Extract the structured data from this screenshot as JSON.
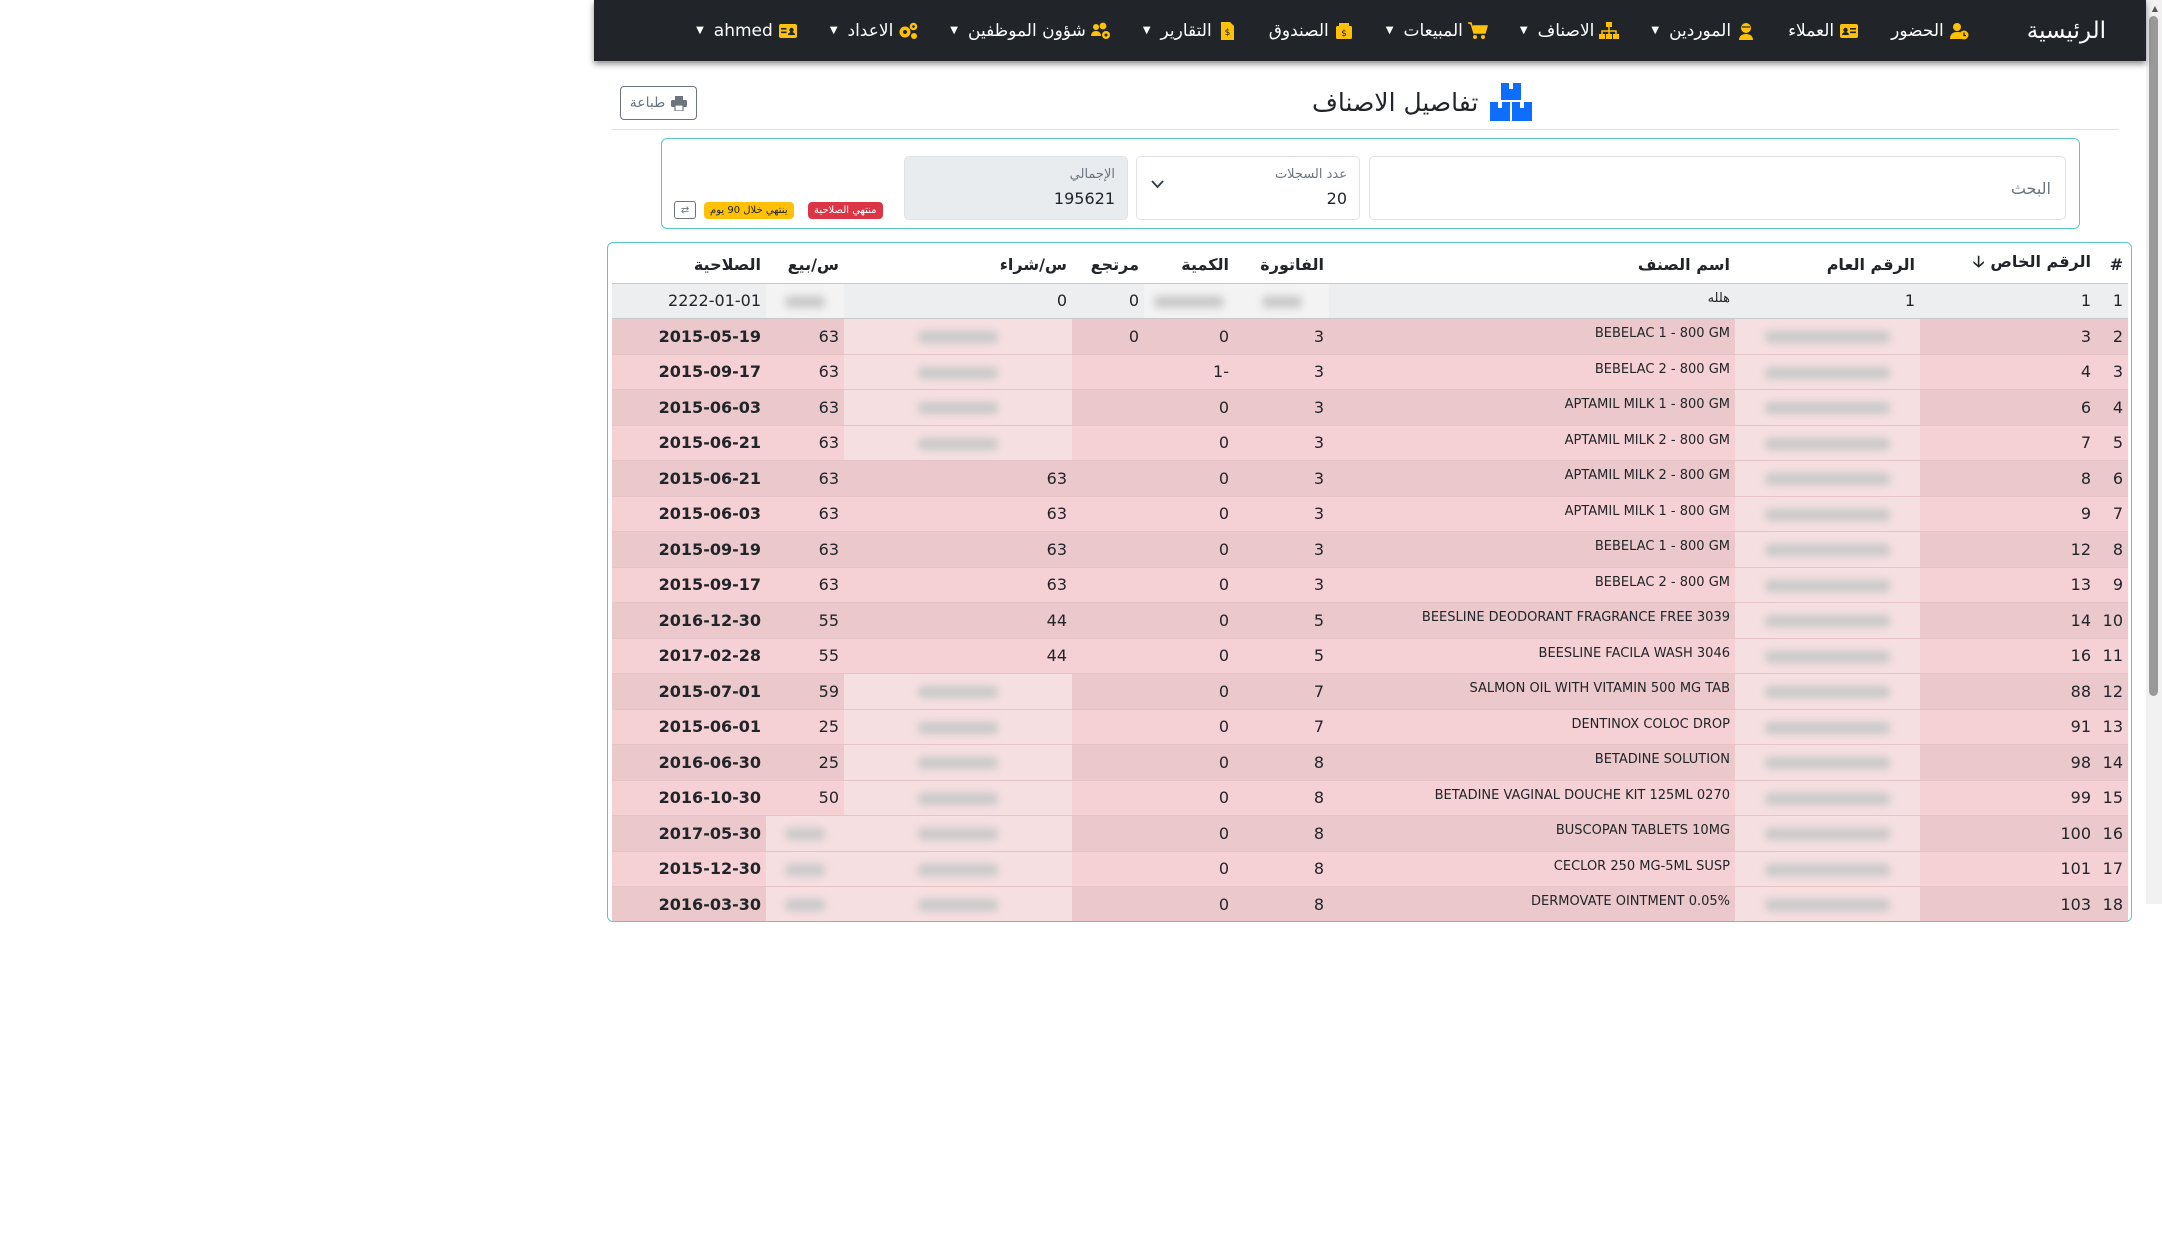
{
  "nav": {
    "brand": "الرئيسية",
    "items": [
      {
        "label": "الحضور",
        "icon": "user-clock-icon",
        "dropdown": false
      },
      {
        "label": "العملاء",
        "icon": "id-card-icon",
        "dropdown": false
      },
      {
        "label": "الموردين",
        "icon": "user-tie-icon",
        "dropdown": true
      },
      {
        "label": "الاصناف",
        "icon": "sitemap-icon",
        "dropdown": true
      },
      {
        "label": "المبيعات",
        "icon": "cart-icon",
        "dropdown": true
      },
      {
        "label": "الصندوق",
        "icon": "cash-box-icon",
        "dropdown": false
      },
      {
        "label": "التقارير",
        "icon": "invoice-icon",
        "dropdown": true
      },
      {
        "label": "شؤون الموظفين",
        "icon": "users-cog-icon",
        "dropdown": true
      },
      {
        "label": "الاعداد",
        "icon": "gears-icon",
        "dropdown": true
      },
      {
        "label": "ahmed",
        "icon": "id-badge-icon",
        "dropdown": true
      }
    ]
  },
  "page": {
    "title": "تفاصيل الاصناف",
    "print_label": "طباعة"
  },
  "filters": {
    "search_placeholder": "البحث",
    "records_label": "عدد السجلات",
    "records_value": "20",
    "total_label": "الإجمالي",
    "total_value": "195621",
    "badge_expired": "منتهي الصلاحية",
    "badge_soon": "ينتهي خلال 90 يوم"
  },
  "table": {
    "headers": [
      "#",
      "الرقم الخاص",
      "الرقم العام",
      "اسم الصنف",
      "الفاتورة",
      "الكمية",
      "مرتجع",
      "س/شراء",
      "س/بيع",
      "الصلاحية"
    ],
    "sort_indicator": "🡣",
    "rows": [
      {
        "n": "1",
        "code": "1",
        "general": "1",
        "name": "هلله",
        "invoice": "",
        "qty": "",
        "ret": "0",
        "buy": "0",
        "sell": "",
        "exp": "2222-01-01"
      },
      {
        "n": "2",
        "code": "3",
        "general": "",
        "name": "BEBELAC 1 - 800 GM",
        "invoice": "3",
        "qty": "0",
        "ret": "0",
        "buy": "",
        "sell": "63",
        "exp": "2015-05-19"
      },
      {
        "n": "3",
        "code": "4",
        "general": "",
        "name": "BEBELAC 2 - 800 GM",
        "invoice": "3",
        "qty": "-1",
        "ret": "",
        "buy": "",
        "sell": "63",
        "exp": "2015-09-17"
      },
      {
        "n": "4",
        "code": "6",
        "general": "",
        "name": "APTAMIL MILK 1 - 800 GM",
        "invoice": "3",
        "qty": "0",
        "ret": "",
        "buy": "",
        "sell": "63",
        "exp": "2015-06-03"
      },
      {
        "n": "5",
        "code": "7",
        "general": "",
        "name": "APTAMIL MILK 2 - 800 GM",
        "invoice": "3",
        "qty": "0",
        "ret": "",
        "buy": "",
        "sell": "63",
        "exp": "2015-06-21"
      },
      {
        "n": "6",
        "code": "8",
        "general": "",
        "name": "APTAMIL MILK 2 - 800 GM",
        "invoice": "3",
        "qty": "0",
        "ret": "",
        "buy": "63",
        "sell": "63",
        "exp": "2015-06-21"
      },
      {
        "n": "7",
        "code": "9",
        "general": "",
        "name": "APTAMIL MILK 1 - 800 GM",
        "invoice": "3",
        "qty": "0",
        "ret": "",
        "buy": "63",
        "sell": "63",
        "exp": "2015-06-03"
      },
      {
        "n": "8",
        "code": "12",
        "general": "",
        "name": "BEBELAC 1 - 800 GM",
        "invoice": "3",
        "qty": "0",
        "ret": "",
        "buy": "63",
        "sell": "63",
        "exp": "2015-09-19"
      },
      {
        "n": "9",
        "code": "13",
        "general": "",
        "name": "BEBELAC 2 - 800 GM",
        "invoice": "3",
        "qty": "0",
        "ret": "",
        "buy": "63",
        "sell": "63",
        "exp": "2015-09-17"
      },
      {
        "n": "10",
        "code": "14",
        "general": "",
        "name": "BEESLINE DEODORANT FRAGRANCE FREE 3039",
        "invoice": "5",
        "qty": "0",
        "ret": "",
        "buy": "44",
        "sell": "55",
        "exp": "2016-12-30"
      },
      {
        "n": "11",
        "code": "16",
        "general": "",
        "name": "BEESLINE FACILA WASH 3046",
        "invoice": "5",
        "qty": "0",
        "ret": "",
        "buy": "44",
        "sell": "55",
        "exp": "2017-02-28"
      },
      {
        "n": "12",
        "code": "88",
        "general": "",
        "name": "SALMON OIL WITH VITAMIN 500 MG TAB",
        "invoice": "7",
        "qty": "0",
        "ret": "",
        "buy": "",
        "sell": "59",
        "exp": "2015-07-01"
      },
      {
        "n": "13",
        "code": "91",
        "general": "",
        "name": "DENTINOX COLOC DROP",
        "invoice": "7",
        "qty": "0",
        "ret": "",
        "buy": "",
        "sell": "25",
        "exp": "2015-06-01"
      },
      {
        "n": "14",
        "code": "98",
        "general": "",
        "name": "BETADINE SOLUTION",
        "invoice": "8",
        "qty": "0",
        "ret": "",
        "buy": "",
        "sell": "25",
        "exp": "2016-06-30"
      },
      {
        "n": "15",
        "code": "99",
        "general": "",
        "name": "BETADINE VAGINAL DOUCHE KIT 125ML 0270",
        "invoice": "8",
        "qty": "0",
        "ret": "",
        "buy": "",
        "sell": "50",
        "exp": "2016-10-30"
      },
      {
        "n": "16",
        "code": "100",
        "general": "",
        "name": "BUSCOPAN TABLETS 10MG",
        "invoice": "8",
        "qty": "0",
        "ret": "",
        "buy": "",
        "sell": "",
        "exp": "2017-05-30"
      },
      {
        "n": "17",
        "code": "101",
        "general": "",
        "name": "CECLOR 250 MG-5ML SUSP",
        "invoice": "8",
        "qty": "0",
        "ret": "",
        "buy": "",
        "sell": "",
        "exp": "2015-12-30"
      },
      {
        "n": "18",
        "code": "103",
        "general": "",
        "name": "DERMOVATE OINTMENT 0.05%",
        "invoice": "8",
        "qty": "0",
        "ret": "",
        "buy": "",
        "sell": "",
        "exp": "2016-03-30"
      }
    ]
  }
}
